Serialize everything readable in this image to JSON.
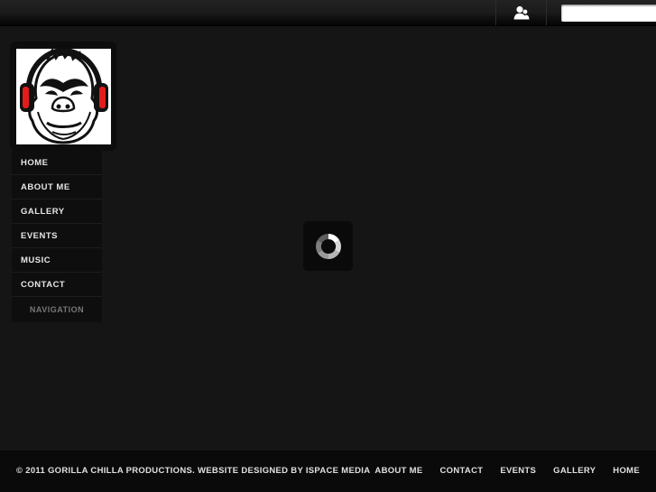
{
  "header": {
    "user_icon": "user-group-icon",
    "search": {
      "value": "",
      "placeholder": ""
    }
  },
  "logo": {
    "alt": "gorilla-with-headphones-logo",
    "accent_color": "#e41b1b"
  },
  "nav": {
    "items": [
      {
        "label": "HOME"
      },
      {
        "label": "ABOUT ME"
      },
      {
        "label": "GALLERY"
      },
      {
        "label": "EVENTS"
      },
      {
        "label": "MUSIC"
      },
      {
        "label": "CONTACT"
      }
    ],
    "caption": "NAVIGATION"
  },
  "loader": {
    "icon": "loading-spinner-icon"
  },
  "footer": {
    "copyright": "© 2011 GORILLA CHILLA PRODUCTIONS. WEBSITE DESIGNED BY ISPACE MEDIA",
    "links": [
      {
        "label": "ABOUT ME"
      },
      {
        "label": "CONTACT"
      },
      {
        "label": "EVENTS"
      },
      {
        "label": "GALLERY"
      },
      {
        "label": "HOME"
      }
    ]
  }
}
